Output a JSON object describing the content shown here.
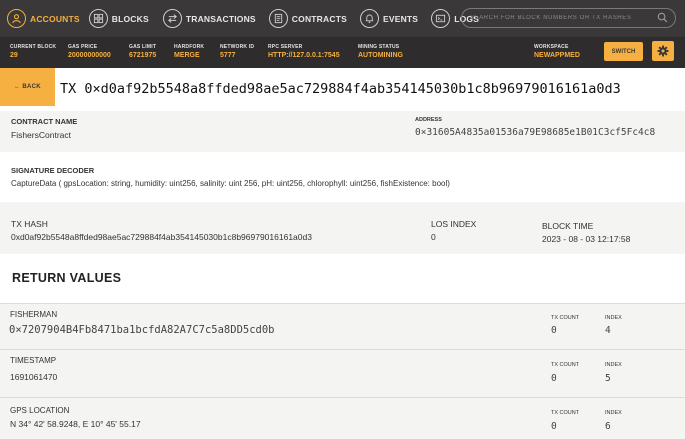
{
  "nav": {
    "items": [
      {
        "label": "ACCOUNTS",
        "icon": "person-icon"
      },
      {
        "label": "BLOCKS",
        "icon": "blocks-icon"
      },
      {
        "label": "TRANSACTIONS",
        "icon": "arrows-icon"
      },
      {
        "label": "CONTRACTS",
        "icon": "document-icon"
      },
      {
        "label": "EVENTS",
        "icon": "bell-icon"
      },
      {
        "label": "LOGS",
        "icon": "terminal-icon"
      }
    ],
    "search_placeholder": "SEARCH FOR BLOCK NUMBERS OR TX HASHES"
  },
  "status": {
    "current_block": {
      "label": "CURRENT BLOCK",
      "value": "29"
    },
    "gas_price": {
      "label": "GAS PRICE",
      "value": "20000000000"
    },
    "gas_limit": {
      "label": "GAS LIMIT",
      "value": "6721975"
    },
    "hardfork": {
      "label": "HARDFORK",
      "value": "MERGE"
    },
    "network_id": {
      "label": "NETWORK ID",
      "value": "5777"
    },
    "rpc_server": {
      "label": "RPC SERVER",
      "value": "HTTP://127.0.0.1:7545"
    },
    "mining_status": {
      "label": "MINING STATUS",
      "value": "AUTOMINING"
    },
    "workspace": {
      "label": "WORKSPACE",
      "value": "NEWAPPMED"
    },
    "switch_label": "SWITCH"
  },
  "header": {
    "back_label": "← BACK",
    "title": "TX 0×d0af92b5548a8ffded98ae5ac729884f4ab354145030b1c8b96979016161a0d3"
  },
  "contract": {
    "name_label": "CONTRACT NAME",
    "name": "FishersContract",
    "address_label": "ADDRESS",
    "address": "0×31605A4835a01536a79E98685e1B01C3cf5Fc4c8"
  },
  "signature": {
    "label": "SIGNATURE DECODER",
    "text": "CaptureData ( gpsLocation: string, humidity: uint256, salinity: uint 256, pH: uint256, chlorophyll: uint256, fishExistence: bool)"
  },
  "tx": {
    "hash_label": "TX HASH",
    "hash": "0xd0af92b5548a8ffded98ae5ac729884f4ab354145030b1c8b96979016161a0d3",
    "index_label": "LOS INDEX",
    "index": "0",
    "time_label": "BLOCK TIME",
    "time": "2023 - 08 - 03 12:17:58"
  },
  "return_values": {
    "title": "RETURN VALUES",
    "rows": [
      {
        "name": "FISHERMAN",
        "value": "0×7207904B4Fb8471ba1bcfdA82A7C7c5a8DD5cd0b",
        "tx_count_label": "TX COUNT",
        "tx_count": "0",
        "index_label": "INDEX",
        "index": "4"
      },
      {
        "name": "TIMESTAMP",
        "value": "1691061470",
        "tx_count_label": "TX COUNT",
        "tx_count": "0",
        "index_label": "INDEX",
        "index": "5"
      },
      {
        "name": "GPS LOCATION",
        "value": "N  34°  42'  58.9248,  E 10° 45'  55.17",
        "tx_count_label": "TX COUNT",
        "tx_count": "0",
        "index_label": "INDEX",
        "index": "6"
      }
    ]
  },
  "colors": {
    "accent": "#f5b041",
    "nav_bg": "#3a3838",
    "status_bg": "#2e2c2c"
  }
}
